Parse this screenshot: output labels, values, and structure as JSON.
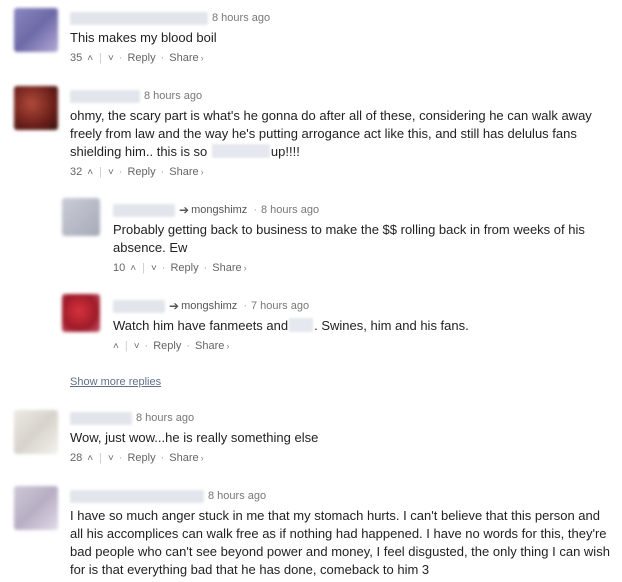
{
  "comments": [
    {
      "timestamp": "8 hours ago",
      "text": "This makes my blood boil",
      "votes": "35",
      "reply": "Reply",
      "share": "Share"
    },
    {
      "timestamp": "8 hours ago",
      "text_before": "ohmy, the scary part is what's he gonna do after all of these, considering he can walk away freely from law and the way he's putting arrogance act like this, and still has delulus fans shielding him.. this is so",
      "text_after": "up!!!!",
      "votes": "32",
      "reply": "Reply",
      "share": "Share"
    },
    {
      "parent": "mongshimz",
      "timestamp": "8 hours ago",
      "text": "Probably getting back to business to make the $$ rolling back in from weeks of his absence. Ew",
      "votes": "10",
      "reply": "Reply",
      "share": "Share"
    },
    {
      "parent": "mongshimz",
      "timestamp": "7 hours ago",
      "text_before": "Watch him have fanmeets and",
      "text_after": ". Swines, him and his fans.",
      "votes": "",
      "reply": "Reply",
      "share": "Share"
    },
    {
      "timestamp": "8 hours ago",
      "text": "Wow, just wow...he is really something else",
      "votes": "28",
      "reply": "Reply",
      "share": "Share"
    },
    {
      "timestamp": "8 hours ago",
      "text": "I have so much anger stuck in me that my stomach hurts. I can't believe that this person and all his accomplices can walk free as if nothing had happened. I have no words for this, they're bad people who can't see beyond power and money, I feel disgusted, the only thing I can wish for is that everything bad that he has done, comeback to him 3"
    }
  ],
  "show_more_replies": "Show more replies",
  "icons": {
    "upvote": "chevron-up-icon",
    "downvote": "chevron-down-icon",
    "reply_to": "reply-arrow-icon",
    "share_caret": "caret-right-icon"
  }
}
